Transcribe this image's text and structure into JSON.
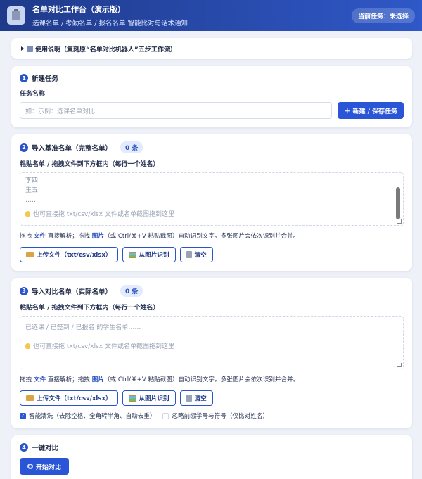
{
  "header": {
    "title": "名单对比工作台（演示版）",
    "subtitle": "选课名单 / 考勤名单 / 报名名单 智能比对与话术通知",
    "task_label": "当前任务：未选择"
  },
  "usage": {
    "label": "使用说明（复刻原“名单对比机器人”五步工作流）"
  },
  "step1": {
    "num": "1",
    "title": "新建任务",
    "field_label": "任务名称",
    "placeholder": "如：示例：选课名单对比",
    "button": "＋ 新建 / 保存任务"
  },
  "step2": {
    "num": "2",
    "title": "导入基准名单（完整名单）",
    "count": "0 条",
    "field_label": "粘贴名单 / 拖拽文件到下方框内（每行一个姓名）",
    "lines": [
      "李四",
      "王五",
      "……"
    ],
    "hint": "也可直接拖 txt/csv/xlsx 文件或名单截图拖到这里",
    "helper_pre": "拖拽 ",
    "helper_file": "文件",
    "helper_mid": " 直接解析；拖拽 ",
    "helper_pic": "图片",
    "helper_post": "（或 Ctrl/⌘+V 粘贴截图）自动识别文字。多张图片会依次识别并合并。",
    "upload": "上传文件（txt/csv/xlsx）",
    "ocr": "从图片识别",
    "clear": "清空"
  },
  "step3": {
    "num": "3",
    "title": "导入对比名单（实际名单）",
    "count": "0 条",
    "field_label": "粘贴名单 / 拖拽文件到下方框内（每行一个姓名）",
    "placeholder": "已选课 / 已签到 / 已报名 的学生名单……",
    "hint": "也可直接拖 txt/csv/xlsx 文件或名单截图拖到这里",
    "helper_pre": "拖拽 ",
    "helper_file": "文件",
    "helper_mid": " 直接解析；拖拽 ",
    "helper_pic": "图片",
    "helper_post": "（或 Ctrl/⌘+V 粘贴截图）自动识别文字。多张图片会依次识别并合并。",
    "upload": "上传文件（txt/csv/xlsx）",
    "ocr": "从图片识别",
    "clear": "清空",
    "check1": "智能清洗（去除空格、全角转半角、自动去重）",
    "check2": "忽略前缀学号与符号（仅比对姓名）"
  },
  "step4": {
    "num": "4",
    "title": "一键对比",
    "button": "开始对比"
  }
}
